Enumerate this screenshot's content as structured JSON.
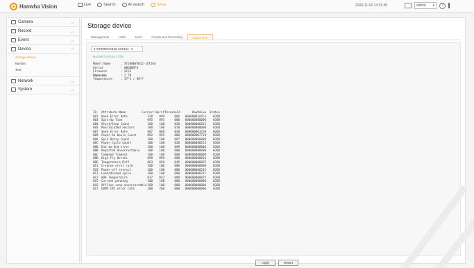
{
  "brand": {
    "name": "Hanwha Vision",
    "accent": "#f39800"
  },
  "topnav": [
    {
      "label": "Live",
      "icon": "monitor-icon"
    },
    {
      "label": "Search",
      "icon": "search-icon"
    },
    {
      "label": "AI search",
      "icon": "ai-search-icon"
    },
    {
      "label": "Setup",
      "icon": "gear-icon"
    }
  ],
  "datetime": "2000-11-03 13:51:38",
  "user": {
    "name": "admin"
  },
  "sidebar": {
    "items": [
      {
        "label": "Camera",
        "icon": "camera-icon"
      },
      {
        "label": "Record",
        "icon": "record-icon"
      },
      {
        "label": "Event",
        "icon": "event-icon"
      },
      {
        "label": "Device",
        "icon": "device-icon",
        "subs": [
          "Storage device",
          "Monitor",
          "Text"
        ]
      },
      {
        "label": "Network",
        "icon": "network-icon"
      },
      {
        "label": "System",
        "icon": "system-icon"
      }
    ]
  },
  "page": {
    "title": "Storage device",
    "tabs": [
      "Management",
      "HDD",
      "NAS",
      "Continuous Recording",
      "S.M.A.R.T"
    ],
    "active_tab": 4
  },
  "smart": {
    "disk_selector": "4-ST2000VX012-1ST164",
    "status_line": "Normal / SATA3 / 2TB",
    "info": [
      {
        "key": "Model Name",
        "value": ": ST2000VX012-1ST164"
      },
      {
        "key": "Serial",
        "value": ": W8G0B5F4"
      },
      {
        "key": "Firmware Version",
        "value": ": SC23"
      },
      {
        "key": "Capacity",
        "value": ": 2 TB"
      },
      {
        "key": "Temperature",
        "value": ": 37°C / 98°F"
      }
    ],
    "header": [
      "ID",
      "Attribute Name",
      "Current",
      "Worst",
      "Threshold",
      "RawValue",
      "Status"
    ],
    "rows": [
      [
        "001",
        "Read Error Rate",
        "120",
        "099",
        "006",
        "00000002A4C3",
        "GOOD"
      ],
      [
        "003",
        "Spin-Up Time",
        "095",
        "095",
        "000",
        "000000000000",
        "GOOD"
      ],
      [
        "004",
        "Start/Stop Count",
        "100",
        "100",
        "020",
        "000000000253",
        "GOOD"
      ],
      [
        "005",
        "Reallocated Sectors",
        "100",
        "100",
        "010",
        "000000000000",
        "GOOD"
      ],
      [
        "007",
        "Seek Error Rate",
        "087",
        "060",
        "030",
        "000000001CA8",
        "GOOD"
      ],
      [
        "009",
        "Power-On Hours Count",
        "092",
        "092",
        "000",
        "000000007718",
        "GOOD"
      ],
      [
        "00A",
        "Spin Retry Count",
        "100",
        "100",
        "097",
        "000000000000",
        "GOOD"
      ],
      [
        "00C",
        "Power Cycle Count",
        "100",
        "100",
        "020",
        "000000000253",
        "GOOD"
      ],
      [
        "0B8",
        "End-to-End error",
        "100",
        "100",
        "099",
        "000000000000",
        "GOOD"
      ],
      [
        "0BB",
        "Reported Uncorrectable",
        "100",
        "100",
        "000",
        "000000000000",
        "GOOD"
      ],
      [
        "0BC",
        "Command Timeout",
        "100",
        "100",
        "000",
        "000000000000",
        "GOOD"
      ],
      [
        "0BD",
        "High Fly Writes",
        "099",
        "099",
        "000",
        "000000000014",
        "GOOD"
      ],
      [
        "0BE",
        "Temperature Diff",
        "063",
        "056",
        "045",
        "000000000025",
        "GOOD"
      ],
      [
        "0C1",
        "G-sense error rate",
        "100",
        "100",
        "000",
        "000000000000",
        "GOOD"
      ],
      [
        "0C0",
        "Power-off retract",
        "100",
        "100",
        "000",
        "000000000243",
        "GOOD"
      ],
      [
        "0C1",
        "Load/Unload cycle",
        "100",
        "100",
        "000",
        "000000000251",
        "GOOD"
      ],
      [
        "0C2",
        "HDA Temperature",
        "037",
        "042",
        "000",
        "000000000025",
        "GOOD"
      ],
      [
        "0C5",
        "Current pending",
        "100",
        "100",
        "000",
        "000000000000",
        "GOOD"
      ],
      [
        "0C6",
        "Offline scan uncorrectable",
        "100",
        "100",
        "000",
        "000000000000",
        "GOOD"
      ],
      [
        "0C7",
        "UDMA CRC error rate",
        "200",
        "200",
        "000",
        "000000000000",
        "GOOD"
      ]
    ]
  },
  "buttons": {
    "apply": "Apply",
    "revert": "Revert"
  }
}
